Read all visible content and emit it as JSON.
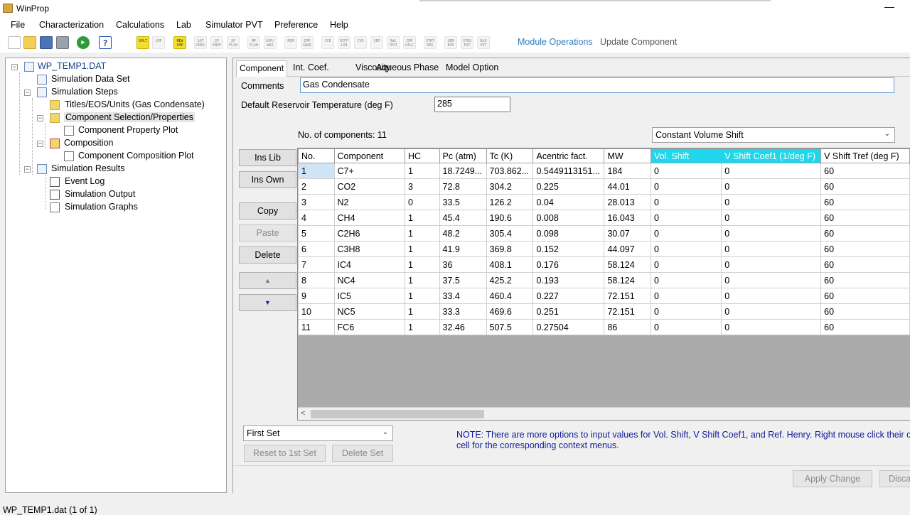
{
  "window": {
    "title": "WinProp"
  },
  "menu": [
    "File",
    "Characterization",
    "Calculations",
    "Lab",
    "Simulator PVT",
    "Preference",
    "Help"
  ],
  "toolbar": {
    "icons": [
      {
        "name": "new-file-icon",
        "label": ""
      },
      {
        "name": "open-folder-icon",
        "label": ""
      },
      {
        "name": "save-icon",
        "label": ""
      },
      {
        "name": "print-icon",
        "label": ""
      },
      {
        "name": "run-icon",
        "label": "▶"
      },
      {
        "name": "help-icon",
        "label": "?"
      },
      {
        "name": "splt-icon",
        "label": "SPLT"
      },
      {
        "name": "lmp-icon",
        "label": "LMP"
      },
      {
        "name": "new-cmp-icon",
        "label": "NEW CMP"
      },
      {
        "name": "sat-pres-icon",
        "label": "SAT PRES"
      },
      {
        "name": "2p-envp-icon",
        "label": "2P ENVP"
      },
      {
        "name": "2p-flsh-icon",
        "label": "2P FLSH"
      },
      {
        "name": "mp-flsh-icon",
        "label": "MP FLSH"
      },
      {
        "name": "asp-wax-icon",
        "label": "ASP/ WAX"
      },
      {
        "name": "mcm-icon",
        "label": "MCM"
      },
      {
        "name": "cmp-grad-icon",
        "label": "CMP GRAD"
      },
      {
        "name": "cce-icon",
        "label": "CCE"
      },
      {
        "name": "diff-lib-icon",
        "label": "DIFF LIB"
      },
      {
        "name": "cvd-icon",
        "label": "CVD"
      },
      {
        "name": "sep-icon",
        "label": "SEP"
      },
      {
        "name": "swl-test-icon",
        "label": "SWL TEST"
      },
      {
        "name": "cmp-calc-icon",
        "label": "CMP CALC"
      },
      {
        "name": "strt-reg-icon",
        "label": "STRT REG"
      },
      {
        "name": "gem-eos-icon",
        "label": "GEM EOS"
      },
      {
        "name": "stars-pvt-icon",
        "label": "STRS PVT"
      },
      {
        "name": "blk-pvt-icon",
        "label": "BLK PVT"
      }
    ],
    "module_operations": "Module Operations",
    "update_component": "Update Component"
  },
  "tree": {
    "root": "WP_TEMP1.DAT",
    "simulation_data_set": "Simulation Data Set",
    "simulation_steps": "Simulation Steps",
    "titles": "Titles/EOS/Units (Gas Condensate)",
    "component_selection": "Component Selection/Properties",
    "component_property_plot": "Component Property Plot",
    "composition": "Composition",
    "component_composition_plot": "Component Composition Plot",
    "simulation_results": "Simulation Results",
    "event_log": "Event Log",
    "simulation_output": "Simulation Output",
    "simulation_graphs": "Simulation Graphs"
  },
  "tabs": [
    "Component",
    "Int. Coef.",
    "Viscosity",
    "Aqueous Phase",
    "Model Option"
  ],
  "form": {
    "comments_label": "Comments",
    "comments_value": "Gas Condensate",
    "temp_label": "Default Reservoir Temperature (deg F)",
    "temp_value": "285",
    "num_components": "No. of components: 11",
    "shift_method": "Constant Volume Shift"
  },
  "buttons": {
    "ins_lib": "Ins Lib",
    "ins_own": "Ins Own",
    "copy": "Copy",
    "paste": "Paste",
    "delete": "Delete",
    "up": "▲",
    "down": "▼",
    "reset": "Reset to 1st Set",
    "delete_set": "Delete Set",
    "apply": "Apply Change",
    "discard": "Disca"
  },
  "set_select": "First Set",
  "grid": {
    "headers": [
      "No.",
      "Component",
      "HC",
      "Pc (atm)",
      "Tc (K)",
      "Acentric fact.",
      "MW",
      "Vol. Shift",
      "V Shift Coef1 (1/deg F)",
      "V Shift Tref (deg F)"
    ],
    "rows": [
      [
        "1",
        "C7+",
        "1",
        "18.7249...",
        "703.862...",
        "0.5449113151...",
        "184",
        "0",
        "0",
        "60"
      ],
      [
        "2",
        "CO2",
        "3",
        "72.8",
        "304.2",
        "0.225",
        "44.01",
        "0",
        "0",
        "60"
      ],
      [
        "3",
        "N2",
        "0",
        "33.5",
        "126.2",
        "0.04",
        "28.013",
        "0",
        "0",
        "60"
      ],
      [
        "4",
        "CH4",
        "1",
        "45.4",
        "190.6",
        "0.008",
        "16.043",
        "0",
        "0",
        "60"
      ],
      [
        "5",
        "C2H6",
        "1",
        "48.2",
        "305.4",
        "0.098",
        "30.07",
        "0",
        "0",
        "60"
      ],
      [
        "6",
        "C3H8",
        "1",
        "41.9",
        "369.8",
        "0.152",
        "44.097",
        "0",
        "0",
        "60"
      ],
      [
        "7",
        "IC4",
        "1",
        "36",
        "408.1",
        "0.176",
        "58.124",
        "0",
        "0",
        "60"
      ],
      [
        "8",
        "NC4",
        "1",
        "37.5",
        "425.2",
        "0.193",
        "58.124",
        "0",
        "0",
        "60"
      ],
      [
        "9",
        "IC5",
        "1",
        "33.4",
        "460.4",
        "0.227",
        "72.151",
        "0",
        "0",
        "60"
      ],
      [
        "10",
        "NC5",
        "1",
        "33.3",
        "469.6",
        "0.251",
        "72.151",
        "0",
        "0",
        "60"
      ],
      [
        "11",
        "FC6",
        "1",
        "32.46",
        "507.5",
        "0.27504",
        "86",
        "0",
        "0",
        "60"
      ]
    ],
    "hscroll_left": "<"
  },
  "note": {
    "line1": "NOTE:  There are more options to input values for Vol. Shift, V Shift Coef1, and Ref. Henry. Right mouse click their colu",
    "line2": "cell for the corresponding context menus."
  },
  "status": "WP_TEMP1.dat (1 of 1)",
  "colors": {
    "accent": "#2d7bbd",
    "header_highlight": "#1fd6ea",
    "note": "#0d1a9a"
  }
}
